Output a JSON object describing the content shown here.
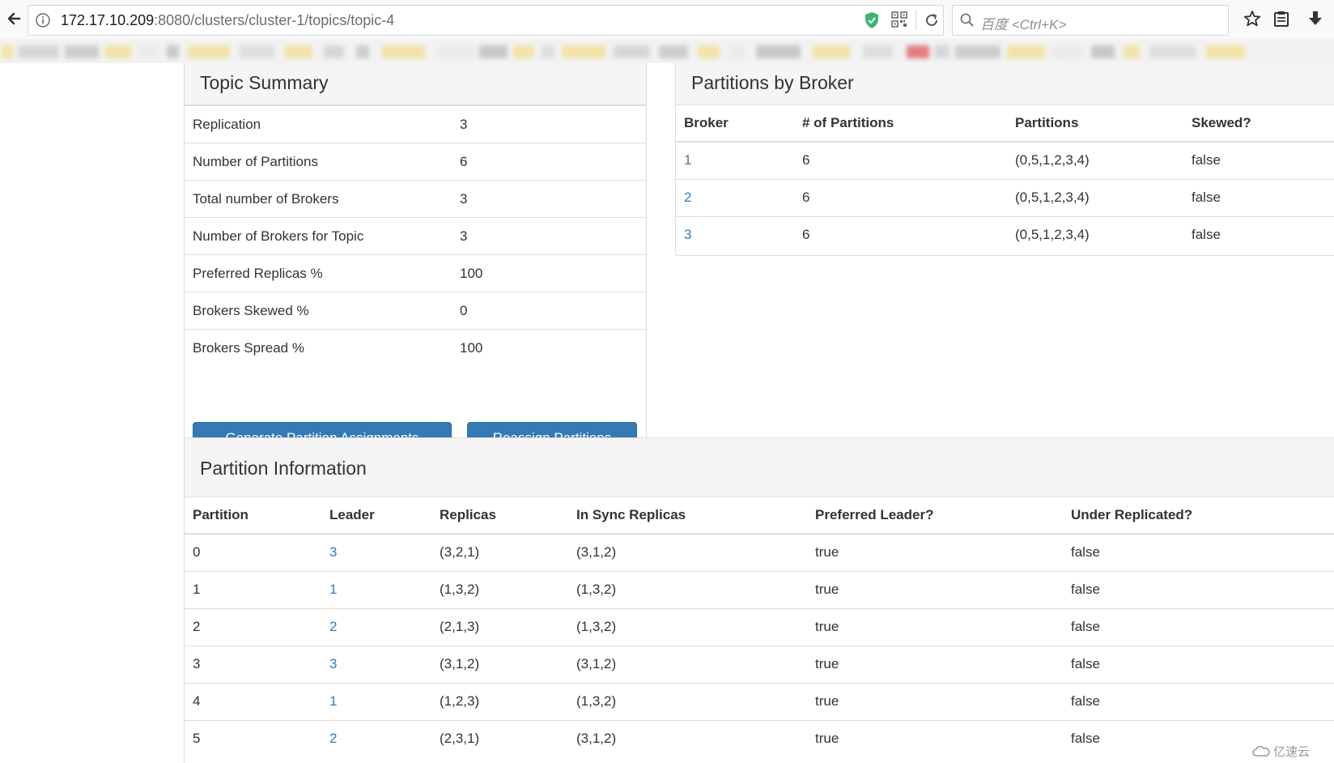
{
  "browser": {
    "url_host": "172.17.10.209",
    "url_path": ":8080/clusters/cluster-1/topics/topic-4",
    "search_placeholder": "百度 <Ctrl+K>"
  },
  "topic_summary": {
    "title": "Topic Summary",
    "rows": [
      {
        "label": "Replication",
        "value": "3"
      },
      {
        "label": "Number of Partitions",
        "value": "6"
      },
      {
        "label": "Total number of Brokers",
        "value": "3"
      },
      {
        "label": "Number of Brokers for Topic",
        "value": "3"
      },
      {
        "label": "Preferred Replicas %",
        "value": "100"
      },
      {
        "label": "Brokers Skewed %",
        "value": "0"
      },
      {
        "label": "Brokers Spread %",
        "value": "100"
      }
    ],
    "buttons": {
      "generate": "Generate Partition Assignments",
      "reassign": "Reassign Partitions"
    }
  },
  "partitions_by_broker": {
    "title": "Partitions by Broker",
    "headers": [
      "Broker",
      "# of Partitions",
      "Partitions",
      "Skewed?"
    ],
    "rows": [
      {
        "broker": "1",
        "count": "6",
        "partitions": "(0,5,1,2,3,4)",
        "skewed": "false"
      },
      {
        "broker": "2",
        "count": "6",
        "partitions": "(0,5,1,2,3,4)",
        "skewed": "false"
      },
      {
        "broker": "3",
        "count": "6",
        "partitions": "(0,5,1,2,3,4)",
        "skewed": "false"
      }
    ]
  },
  "partition_information": {
    "title": "Partition Information",
    "headers": [
      "Partition",
      "Leader",
      "Replicas",
      "In Sync Replicas",
      "Preferred Leader?",
      "Under Replicated?"
    ],
    "rows": [
      {
        "partition": "0",
        "leader": "3",
        "replicas": "(3,2,1)",
        "isr": "(3,1,2)",
        "preferred": "true",
        "under": "false"
      },
      {
        "partition": "1",
        "leader": "1",
        "replicas": "(1,3,2)",
        "isr": "(1,3,2)",
        "preferred": "true",
        "under": "false"
      },
      {
        "partition": "2",
        "leader": "2",
        "replicas": "(2,1,3)",
        "isr": "(1,3,2)",
        "preferred": "true",
        "under": "false"
      },
      {
        "partition": "3",
        "leader": "3",
        "replicas": "(3,1,2)",
        "isr": "(3,1,2)",
        "preferred": "true",
        "under": "false"
      },
      {
        "partition": "4",
        "leader": "1",
        "replicas": "(1,2,3)",
        "isr": "(1,3,2)",
        "preferred": "true",
        "under": "false"
      },
      {
        "partition": "5",
        "leader": "2",
        "replicas": "(2,3,1)",
        "isr": "(3,1,2)",
        "preferred": "true",
        "under": "false"
      }
    ]
  },
  "watermark": "亿速云"
}
